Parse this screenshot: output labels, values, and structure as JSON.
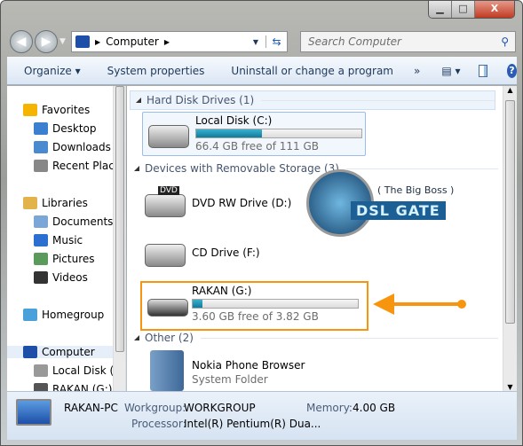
{
  "window": {
    "controls": [
      "minimize",
      "maximize",
      "close"
    ]
  },
  "address": {
    "crumbs": [
      "Computer"
    ],
    "search_placeholder": "Search Computer"
  },
  "toolbar": {
    "organize": "Organize ▾",
    "system_properties": "System properties",
    "uninstall": "Uninstall or change a program",
    "more": "»"
  },
  "nav": {
    "items": [
      {
        "label": "Favorites",
        "icon": "star-icon"
      },
      {
        "label": "Desktop",
        "icon": "desktop-icon"
      },
      {
        "label": "Downloads",
        "icon": "downloads-icon"
      },
      {
        "label": "Recent Places",
        "icon": "recent-places-icon"
      },
      {
        "label": "Libraries",
        "icon": "libraries-icon"
      },
      {
        "label": "Documents",
        "icon": "documents-icon"
      },
      {
        "label": "Music",
        "icon": "music-icon"
      },
      {
        "label": "Pictures",
        "icon": "pictures-icon"
      },
      {
        "label": "Videos",
        "icon": "videos-icon"
      },
      {
        "label": "Homegroup",
        "icon": "homegroup-icon"
      },
      {
        "label": "Computer",
        "icon": "computer-icon"
      },
      {
        "label": "Local Disk (C:)",
        "icon": "drive-icon"
      },
      {
        "label": "RAKAN (G:)",
        "icon": "usb-drive-icon"
      }
    ]
  },
  "groups": {
    "hdd": {
      "title": "Hard Disk Drives (1)"
    },
    "removable": {
      "title": "Devices with Removable Storage (3)"
    },
    "other": {
      "title": "Other (2)"
    }
  },
  "drives": {
    "c": {
      "name": "Local Disk (C:)",
      "info": "66.4 GB free of 111 GB",
      "used_percent": 40
    },
    "d": {
      "name": "DVD RW Drive (D:)",
      "badge": "DVD"
    },
    "f": {
      "name": "CD Drive (F:)"
    },
    "g": {
      "name": "RAKAN (G:)",
      "info": "3.60 GB free of 3.82 GB",
      "used_percent": 6
    },
    "nokia": {
      "name": "Nokia Phone Browser",
      "sub": "System Folder"
    }
  },
  "watermark": {
    "tagline": "( The Big Boss )",
    "brand": "DSL GATE"
  },
  "details": {
    "pc": "RAKAN-PC",
    "workgroup_label": "Workgroup:",
    "workgroup": "WORKGROUP",
    "memory_label": "Memory:",
    "memory": "4.00 GB",
    "processor_label": "Processor:",
    "processor": "Intel(R) Pentium(R) Dua..."
  },
  "colors": {
    "highlight": "#f7960e",
    "bar": "#1c8fb0"
  }
}
